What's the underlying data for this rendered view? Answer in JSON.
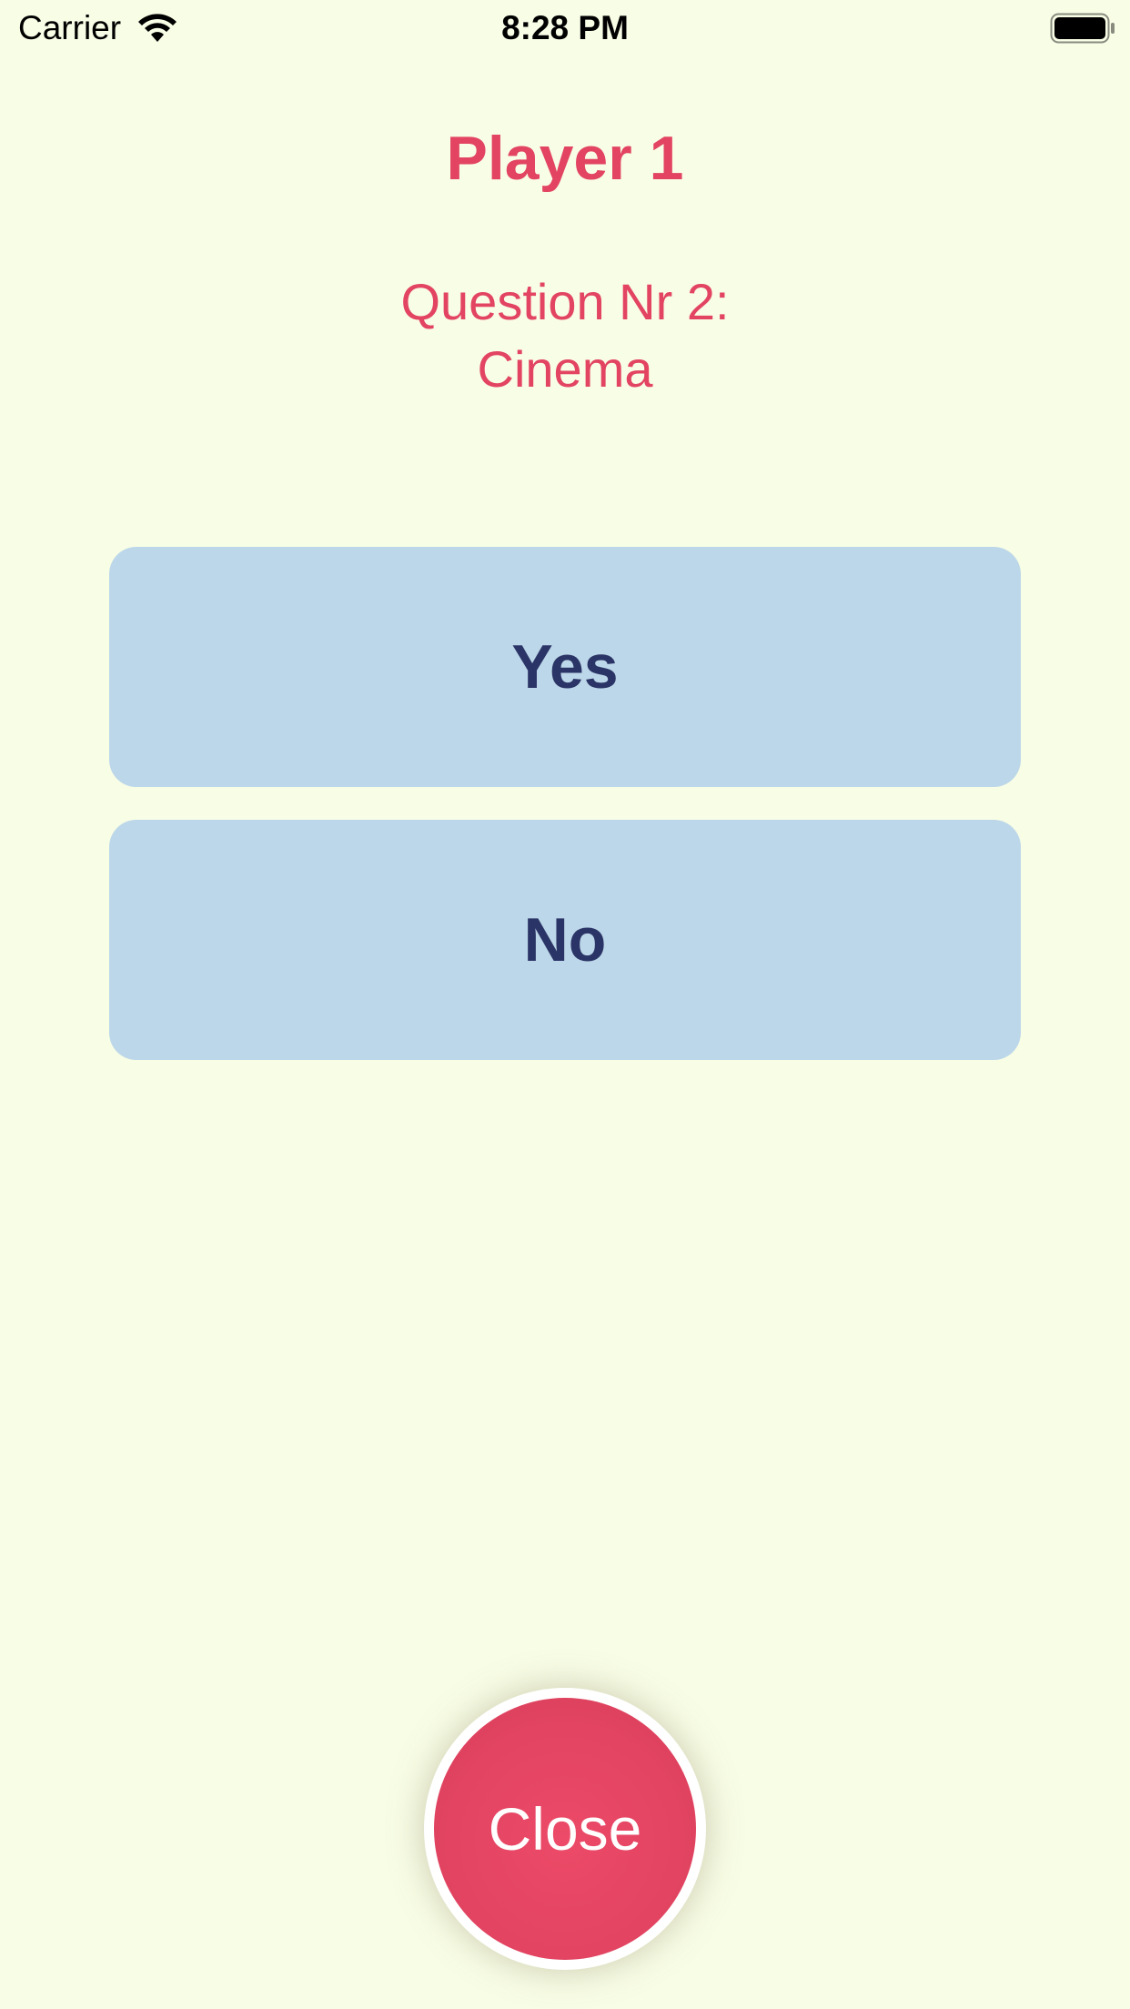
{
  "status_bar": {
    "carrier": "Carrier",
    "time": "8:28 PM",
    "icons": [
      "wifi-icon",
      "battery-icon"
    ]
  },
  "header": {
    "player": "Player 1",
    "question_line1": "Question Nr 2:",
    "question_line2": "Cinema"
  },
  "answers": {
    "yes_label": "Yes",
    "no_label": "No"
  },
  "footer": {
    "close_label": "Close"
  },
  "colors": {
    "background": "#f8fde6",
    "accent": "#e24461",
    "answer_button": "#bcd7e9",
    "answer_text": "#2b3466"
  }
}
